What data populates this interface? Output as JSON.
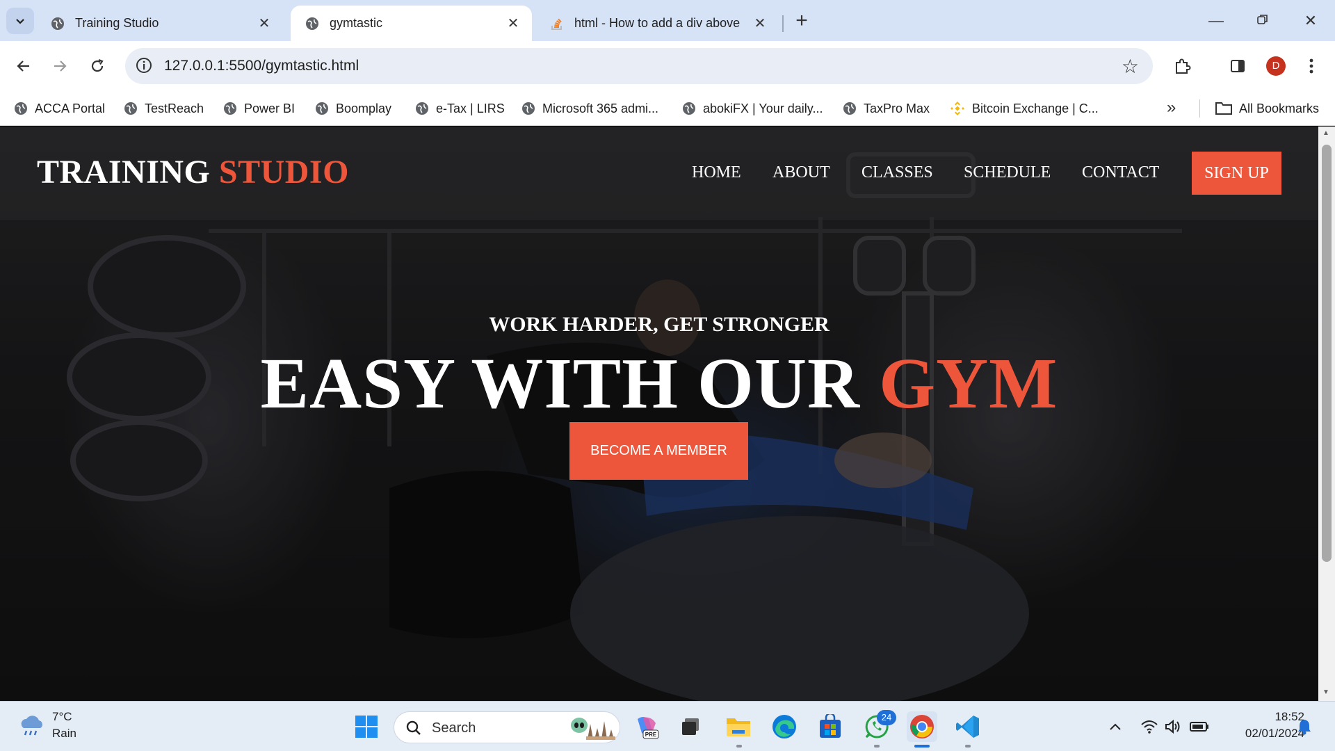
{
  "browser": {
    "tabs": [
      {
        "title": "Training Studio",
        "active": false
      },
      {
        "title": "gymtastic",
        "active": true
      },
      {
        "title": "html - How to add a div above",
        "active": false
      }
    ],
    "url": "127.0.0.1:5500/gymtastic.html",
    "profile_initial": "D",
    "bookmarks": [
      "ACCA Portal",
      "TestReach",
      "Power BI",
      "Boomplay",
      "e-Tax | LIRS",
      "Microsoft 365 admi...",
      "abokiFX | Your daily...",
      "TaxPro Max",
      "Bitcoin Exchange | C..."
    ],
    "all_bookmarks_label": "All Bookmarks"
  },
  "site": {
    "logo_main": "TRAINING",
    "logo_accent": "STUDIO",
    "nav": [
      "HOME",
      "ABOUT",
      "CLASSES",
      "SCHEDULE",
      "CONTACT"
    ],
    "signup_label": "SIGN UP",
    "hero_subtitle": "WORK HARDER, GET STRONGER",
    "hero_title_main": "EASY WITH OUR",
    "hero_title_accent": "GYM",
    "cta_label": "BECOME A MEMBER",
    "accent_color": "#ed563b"
  },
  "taskbar": {
    "weather_temp": "7°C",
    "weather_condition": "Rain",
    "search_label": "Search",
    "whatsapp_badge": "24",
    "time": "18:52",
    "date": "02/01/2024"
  }
}
